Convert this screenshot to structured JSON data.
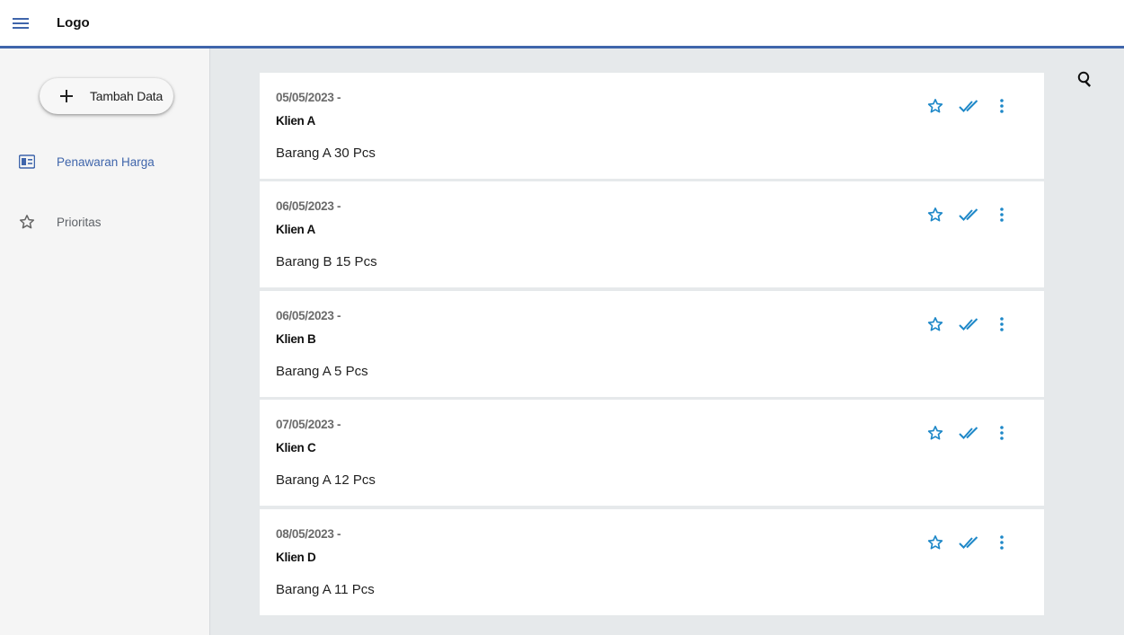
{
  "header": {
    "logo": "Logo"
  },
  "sidebar": {
    "add_button_label": "Tambah Data",
    "items": [
      {
        "label": "Penawaran Harga",
        "icon": "price-card-icon",
        "active": true
      },
      {
        "label": "Prioritas",
        "icon": "star-icon",
        "active": false
      }
    ]
  },
  "colors": {
    "accent": "#3f65ab",
    "action_blue": "#1e88c8",
    "sidebar_bg": "#f5f5f5",
    "content_bg": "#e6e9eb"
  },
  "cards": [
    {
      "date": "05/05/2023 -",
      "client": "Klien A",
      "desc": "Barang A 30 Pcs"
    },
    {
      "date": "06/05/2023 -",
      "client": "Klien A",
      "desc": "Barang B 15 Pcs"
    },
    {
      "date": "06/05/2023 -",
      "client": "Klien B",
      "desc": "Barang A 5 Pcs"
    },
    {
      "date": "07/05/2023 -",
      "client": "Klien C",
      "desc": "Barang A 12 Pcs"
    },
    {
      "date": "08/05/2023 -",
      "client": "Klien D",
      "desc": "Barang A 11 Pcs"
    }
  ]
}
